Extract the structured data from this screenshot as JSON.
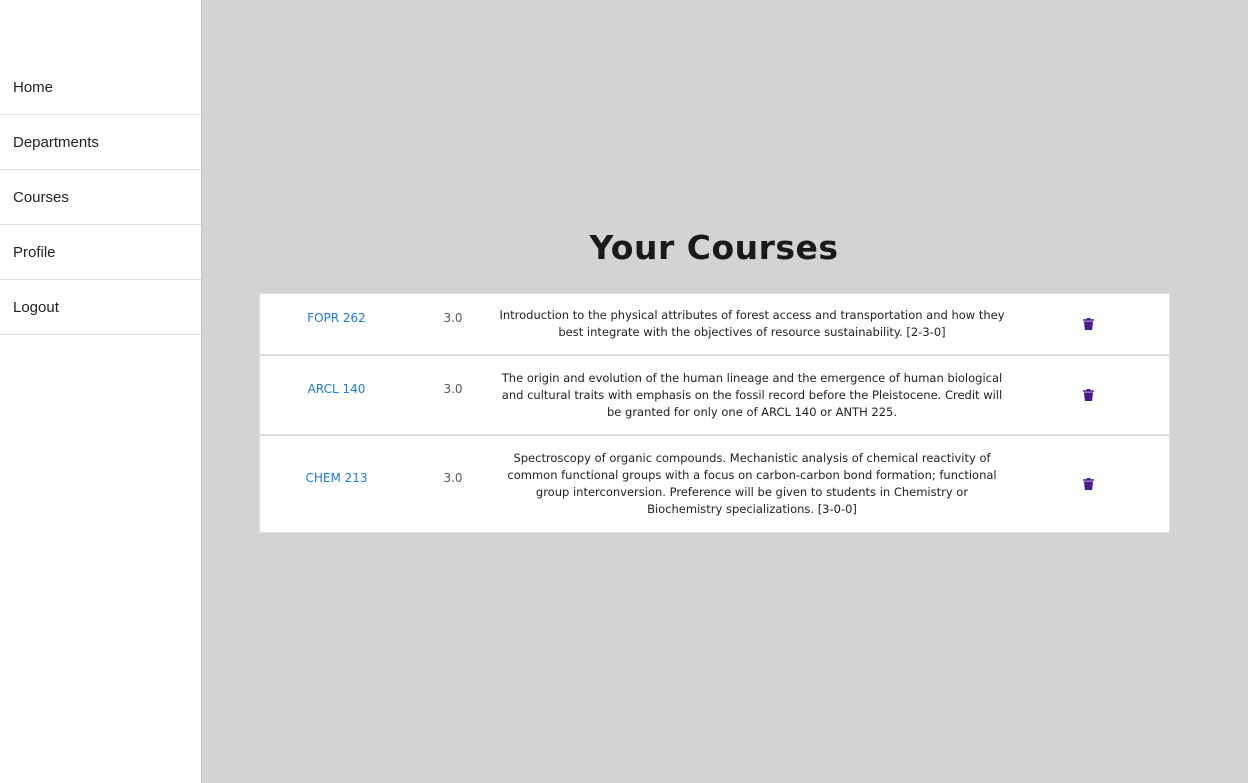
{
  "sidebar": {
    "items": [
      {
        "label": "Home"
      },
      {
        "label": "Departments"
      },
      {
        "label": "Courses"
      },
      {
        "label": "Profile"
      },
      {
        "label": "Logout"
      }
    ]
  },
  "main": {
    "title": "Your Courses",
    "courses": [
      {
        "code": "FOPR 262",
        "credits": "3.0",
        "description": "Introduction to the physical attributes of forest access and transportation and how they best integrate with the objectives of resource sustainability. [2-3-0]",
        "action_icon": "trash-icon"
      },
      {
        "code": "ARCL 140",
        "credits": "3.0",
        "description": "The origin and evolution of the human lineage and the emergence of human biological and cultural traits with emphasis on the fossil record before the Pleistocene. Credit will be granted for only one of ARCL 140 or ANTH 225.",
        "action_icon": "trash-icon"
      },
      {
        "code": "CHEM 213",
        "credits": "3.0",
        "description": "Spectroscopy of organic compounds. Mechanistic analysis of chemical reactivity of common functional groups with a focus on carbon-carbon bond formation; functional group interconversion. Preference will be given to students in Chemistry or Biochemistry specializations. [3-0-0]",
        "action_icon": "trash-icon"
      }
    ]
  },
  "colors": {
    "background": "#d3d3d3",
    "sidebar": "#ffffff",
    "link": "#1f7ae0",
    "trash_icon": "#4a1a8a"
  }
}
